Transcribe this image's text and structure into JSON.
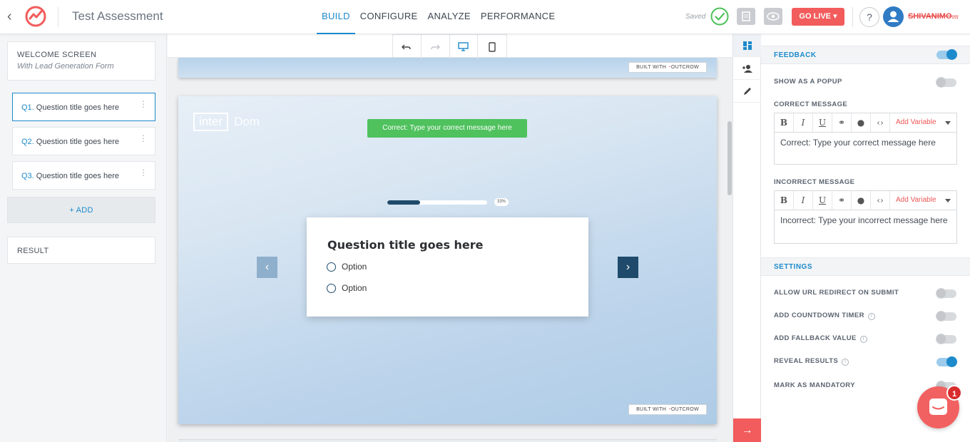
{
  "app": {
    "title": "Test Assessment",
    "saved_label": "Saved",
    "go_live_label": "GO LIVE",
    "help_label": "?",
    "username": "SHIVANIMO..."
  },
  "nav": {
    "tabs": [
      {
        "label": "BUILD",
        "active": true
      },
      {
        "label": "CONFIGURE",
        "active": false
      },
      {
        "label": "ANALYZE",
        "active": false
      },
      {
        "label": "PERFORMANCE",
        "active": false
      }
    ]
  },
  "sidebar": {
    "welcome": {
      "title": "WELCOME SCREEN",
      "subtitle": "With Lead Generation Form"
    },
    "questions": [
      {
        "num": "Q1.",
        "label": "Question title goes here",
        "selected": true
      },
      {
        "num": "Q2.",
        "label": "Question title goes here",
        "selected": false
      },
      {
        "num": "Q3.",
        "label": "Question title goes here",
        "selected": false
      }
    ],
    "add_label": "+ ADD",
    "result_label": "RESULT"
  },
  "canvas": {
    "built_with": "BUILT WITH",
    "built_brand": "OUTCROW",
    "brand_part1": "inter",
    "brand_part2": "Dom",
    "correct_banner": "Correct: Type your correct message here",
    "progress": {
      "fraction": 0.33,
      "label": "33%"
    },
    "question_title": "Question title goes here",
    "options": [
      "Option",
      "Option"
    ]
  },
  "right_panel": {
    "feedback_header": "FEEDBACK",
    "show_popup_label": "SHOW AS A POPUP",
    "correct_message_label": "CORRECT MESSAGE",
    "correct_message_text": "Correct: Type your correct message here",
    "incorrect_message_label": "INCORRECT MESSAGE",
    "incorrect_message_text": "Incorrect: Type your incorrect message here",
    "add_variable_label": "Add Variable",
    "settings_header": "SETTINGS",
    "settings": [
      {
        "label": "ALLOW URL REDIRECT ON SUBMIT",
        "info": false,
        "on": false
      },
      {
        "label": "ADD COUNTDOWN TIMER",
        "info": true,
        "on": false
      },
      {
        "label": "ADD FALLBACK VALUE",
        "info": true,
        "on": false
      },
      {
        "label": "REVEAL RESULTS",
        "info": true,
        "on": true
      },
      {
        "label": "MARK AS MANDATORY",
        "info": false,
        "on": false
      }
    ],
    "feedback_on": true,
    "popup_on": false
  },
  "chat": {
    "badge_count": "1"
  },
  "colors": {
    "accent": "#1d8acb",
    "brand_red": "#f25c5c",
    "success": "#4fc15d",
    "dark_navy": "#1f4a6b"
  }
}
